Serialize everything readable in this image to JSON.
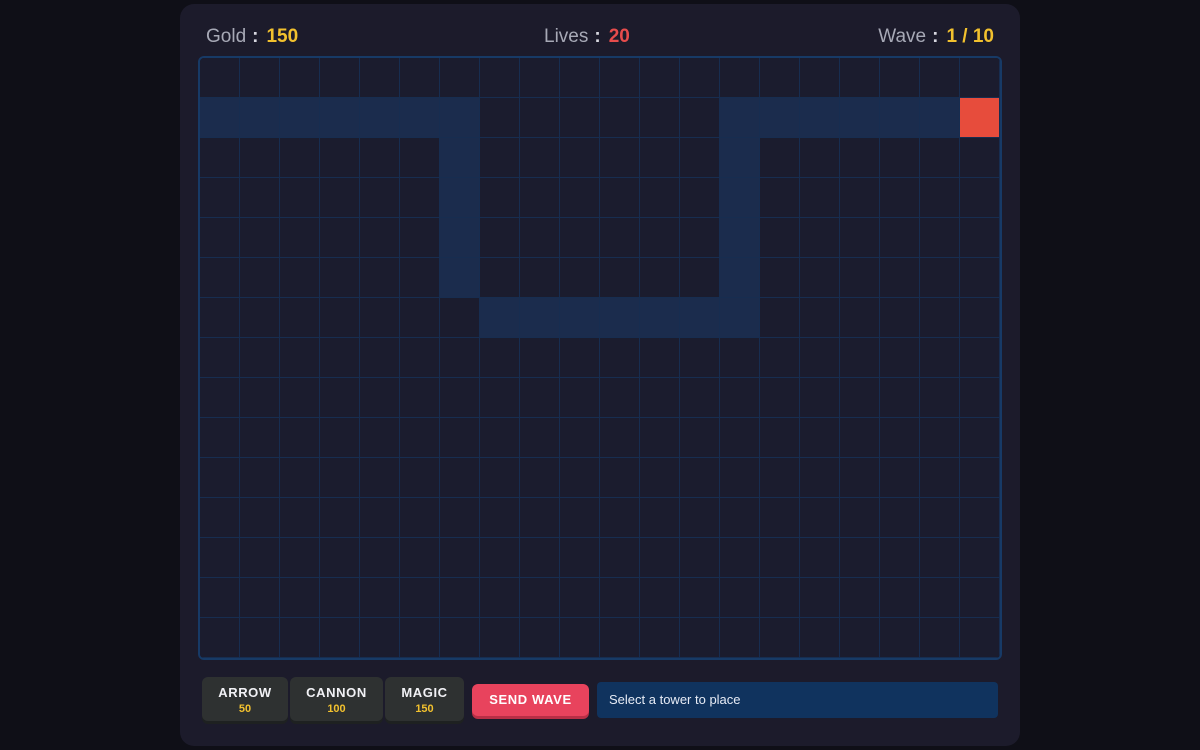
{
  "hud": {
    "gold_label": "Gold",
    "gold_value": "150",
    "lives_label": "Lives",
    "lives_value": "20",
    "wave_label": "Wave",
    "wave_value": "1 / 10",
    "separator": ":"
  },
  "board": {
    "cols": 20,
    "rows": 15,
    "path_cells": [
      [
        1,
        0
      ],
      [
        1,
        1
      ],
      [
        1,
        2
      ],
      [
        1,
        3
      ],
      [
        1,
        4
      ],
      [
        1,
        5
      ],
      [
        1,
        6
      ],
      [
        2,
        6
      ],
      [
        3,
        6
      ],
      [
        4,
        6
      ],
      [
        5,
        6
      ],
      [
        6,
        7
      ],
      [
        6,
        8
      ],
      [
        6,
        9
      ],
      [
        6,
        10
      ],
      [
        6,
        11
      ],
      [
        6,
        12
      ],
      [
        6,
        13
      ],
      [
        5,
        13
      ],
      [
        4,
        13
      ],
      [
        3,
        13
      ],
      [
        2,
        13
      ],
      [
        1,
        13
      ],
      [
        1,
        14
      ],
      [
        1,
        15
      ],
      [
        1,
        16
      ],
      [
        1,
        17
      ],
      [
        1,
        18
      ]
    ],
    "end_cell": [
      1,
      19
    ],
    "end_icon": "",
    "end_icon_name": "flag-icon",
    "colors": {
      "cell": "#1b1c2e",
      "path": "#1b2c4d",
      "grid_line": "#172d50",
      "end": "#e74c3c"
    }
  },
  "towers": [
    {
      "name": "ARROW",
      "cost": "50"
    },
    {
      "name": "CANNON",
      "cost": "100"
    },
    {
      "name": "MAGIC",
      "cost": "150"
    }
  ],
  "coin_icon": "",
  "send_wave_label": "SEND WAVE",
  "status_text": "Select a tower to place",
  "accent_colors": {
    "gold": "#f2c12e",
    "lives": "#e74c4c",
    "send_wave": "#e8435d",
    "status_bg": "#10335e"
  }
}
